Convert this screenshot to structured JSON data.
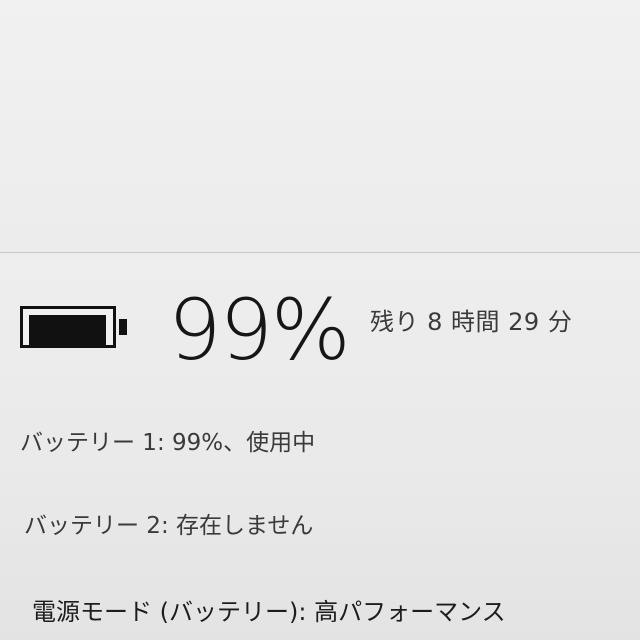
{
  "battery": {
    "level_fraction": 0.99,
    "percent_label": "99%",
    "time_remaining": "残り 8 時間 29 分"
  },
  "details": [
    {
      "text": "バッテリー 1: 99%、使用中"
    },
    {
      "text": "バッテリー 2: 存在しません"
    }
  ],
  "power_mode": {
    "text": "電源モード (バッテリー): 高パフォーマンス"
  },
  "icons": {
    "battery": "battery-icon"
  },
  "colors": {
    "background": "#ececec",
    "text": "#1f1f1f",
    "secondary_text": "#3a3a3a"
  }
}
